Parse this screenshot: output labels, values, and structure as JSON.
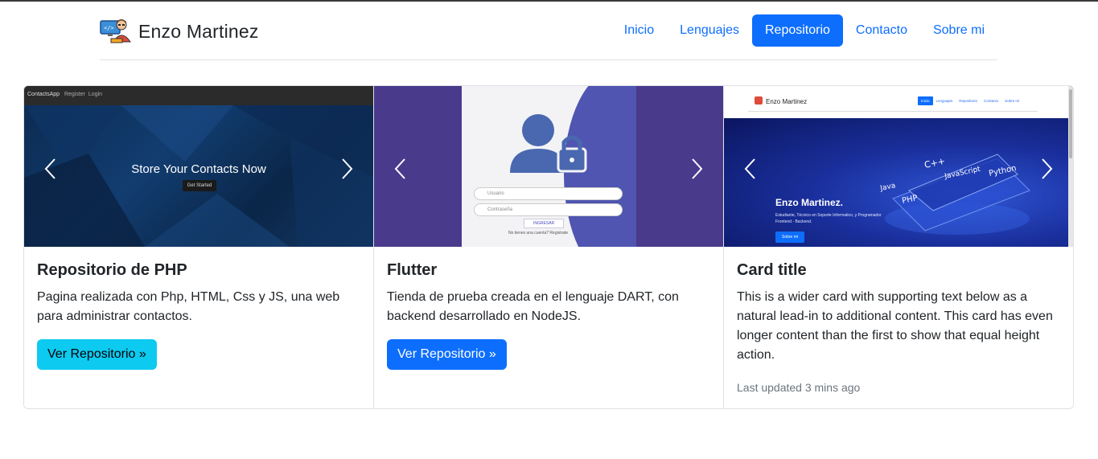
{
  "header": {
    "brand_name": "Enzo Martinez",
    "nav": [
      {
        "label": "Inicio",
        "active": false
      },
      {
        "label": "Lenguajes",
        "active": false
      },
      {
        "label": "Repositorio",
        "active": true
      },
      {
        "label": "Contacto",
        "active": false
      },
      {
        "label": "Sobre mi",
        "active": false
      }
    ]
  },
  "cards": [
    {
      "title": "Repositorio de PHP",
      "text": "Pagina realizada con Php, HTML, Css y JS, una web para administrar contactos.",
      "button": "Ver Repositorio »",
      "slide": {
        "app_brand": "ContactsApp",
        "nav_links": [
          "Register",
          "Login"
        ],
        "heading": "Store Your Contacts Now",
        "cta": "Get Started"
      }
    },
    {
      "title": "Flutter",
      "text": "Tienda de prueba creada en el lenguaje DART, con backend desarrollado en NodeJS.",
      "button": "Ver Repositorio »",
      "slide": {
        "user_placeholder": "Usuario",
        "pass_placeholder": "Contraseña",
        "login": "INGRESAR",
        "register_prompt": "No tienes una cuenta? Registrate"
      }
    },
    {
      "title": "Card title",
      "text": "This is a wider card with supporting text below as a natural lead-in to additional content. This card has even longer content than the first to show that equal height action.",
      "footer": "Last updated 3 mins ago",
      "slide": {
        "brand": "Enzo Martinez",
        "nav": [
          "Inicio",
          "Lenguajes",
          "Repositorio",
          "Contacto",
          "Sobre mi"
        ],
        "hero_title": "Enzo Martinez.",
        "hero_sub": "Estudiante, Técnico en Soporte Informatico, y Programador Frontend - Backend.",
        "hero_button": "Sobre mi",
        "code_words": [
          "C++",
          "JavaScript",
          "Python",
          "Java",
          "PHP"
        ]
      }
    }
  ],
  "colors": {
    "primary": "#0d6efd",
    "info": "#0dcaf0",
    "muted": "#6c757d",
    "border": "#dee2e6"
  }
}
